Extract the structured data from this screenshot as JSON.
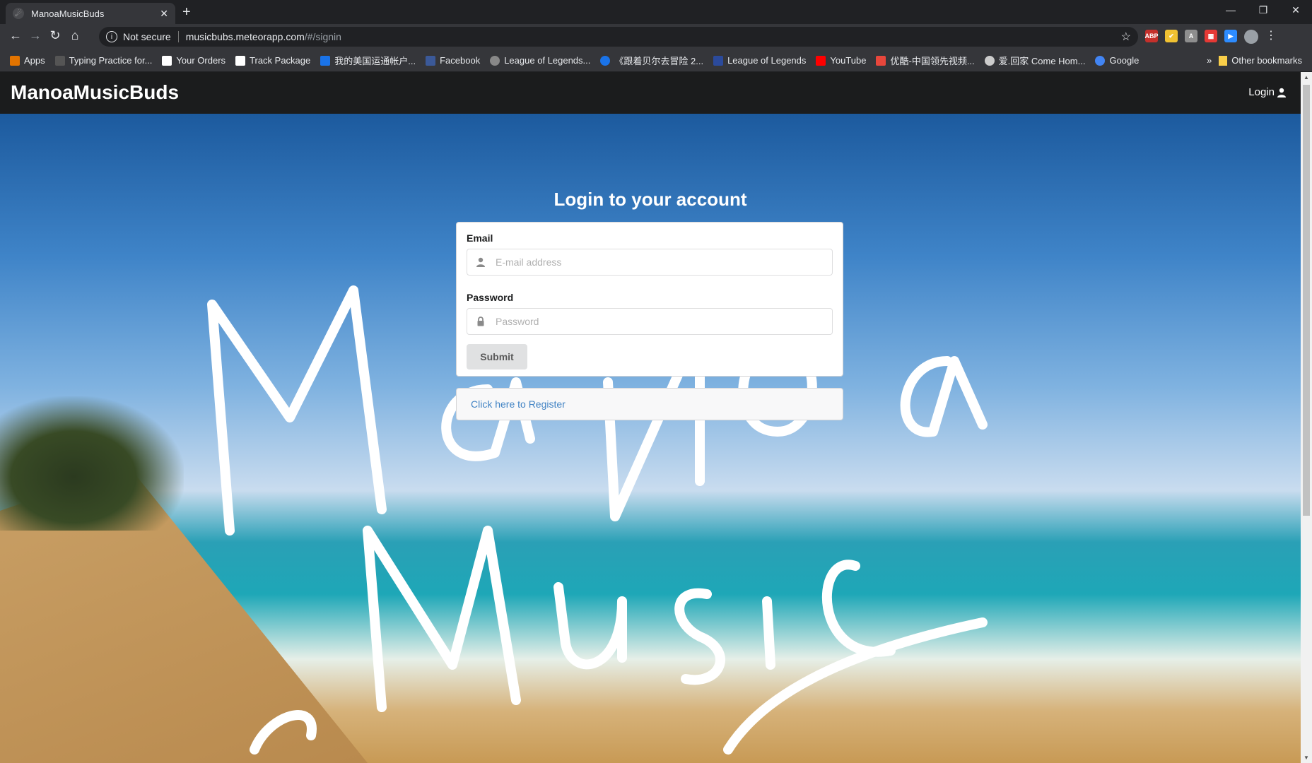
{
  "browser": {
    "tab_title": "ManoaMusicBuds",
    "new_tab": "+",
    "window_controls": [
      "—",
      "❐",
      "✕"
    ],
    "security": "Not secure",
    "url_host": "musicbubs.meteorapp.com",
    "url_path": "/#/signin",
    "bookmarks": [
      {
        "label": "Apps",
        "color": "#e37400"
      },
      {
        "label": "Typing Practice for...",
        "color": "#333333"
      },
      {
        "label": "Your Orders",
        "color": "#ffffff"
      },
      {
        "label": "Track Package",
        "color": "#ffffff"
      },
      {
        "label": "我的美国运通帐户...",
        "color": "#1a73e8"
      },
      {
        "label": "Facebook",
        "color": "#3b5998"
      },
      {
        "label": "League of Legends...",
        "color": "#888888"
      },
      {
        "label": "《跟着贝尔去冒险 2...",
        "color": "#1a73e8"
      },
      {
        "label": "League of Legends",
        "color": "#2b4a9b"
      },
      {
        "label": "YouTube",
        "color": "#ff0000"
      },
      {
        "label": "优酷-中国领先视频...",
        "color": "#e8473c"
      },
      {
        "label": "爱.回家 Come Hom...",
        "color": "#cccccc"
      },
      {
        "label": "Google",
        "color": "#4285f4"
      }
    ],
    "more": "»",
    "other_bookmarks": "Other bookmarks"
  },
  "navbar": {
    "brand": "ManoaMusicBuds",
    "login": "Login"
  },
  "signin": {
    "title": "Login to your account",
    "email_label": "Email",
    "email_placeholder": "E-mail address",
    "password_label": "Password",
    "password_placeholder": "Password",
    "submit": "Submit",
    "register_link": "Click here to Register"
  },
  "colors": {
    "navbar": "#1b1c1d",
    "link": "#4183c4",
    "button": "#e0e1e2"
  }
}
